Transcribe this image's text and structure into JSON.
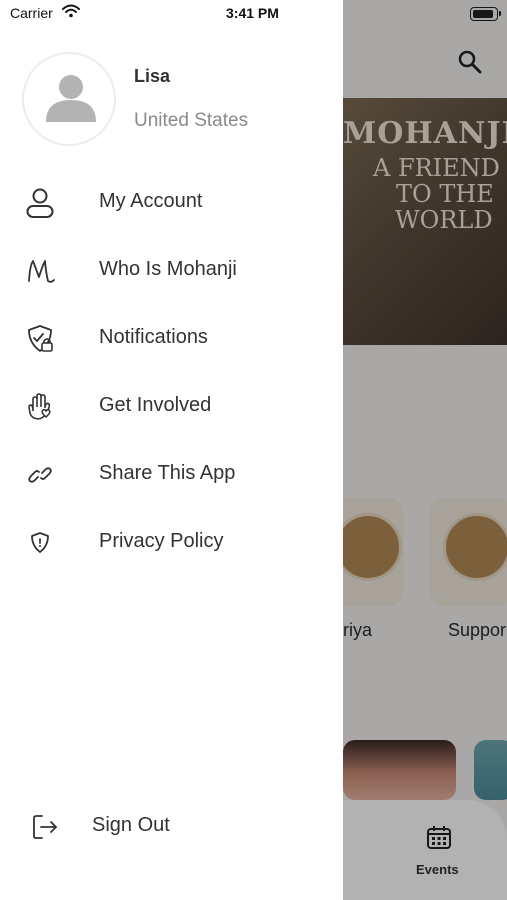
{
  "status_bar": {
    "carrier": "Carrier",
    "time": "3:41 PM"
  },
  "profile": {
    "name": "Lisa",
    "country": "United States"
  },
  "menu": {
    "items": [
      {
        "label": "My Account",
        "icon": "user-icon"
      },
      {
        "label": "Who Is Mohanji",
        "icon": "mohanji-logo-icon"
      },
      {
        "label": "Notifications",
        "icon": "shield-lock-icon"
      },
      {
        "label": "Get Involved",
        "icon": "hand-heart-icon"
      },
      {
        "label": "Share This App",
        "icon": "link-icon"
      },
      {
        "label": "Privacy Policy",
        "icon": "shield-icon"
      }
    ],
    "sign_out": {
      "label": "Sign Out",
      "icon": "logout-icon"
    }
  },
  "background": {
    "banner": {
      "line1": "MOHANJI",
      "line2": "A FRIEND",
      "line3": "TO THE",
      "line4": "WORLD"
    },
    "cards": {
      "card1_label": "riya",
      "card2_label": "Suppor"
    },
    "tabbar": {
      "events_label": "Events"
    }
  },
  "colors": {
    "text": "#333333",
    "secondary_text": "#8a8a8a",
    "accent": "#b08a55",
    "overlay": "rgba(0,0,0,0.30)"
  }
}
